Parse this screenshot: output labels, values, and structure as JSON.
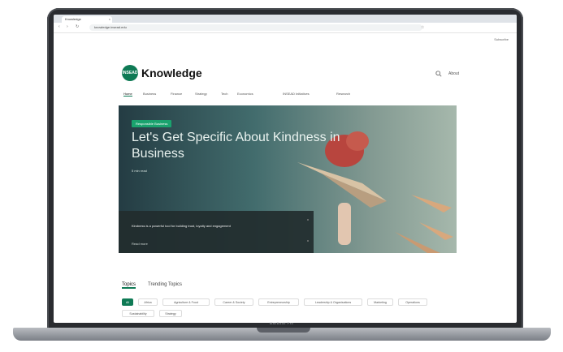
{
  "device": {
    "label": "MacBook Pro"
  },
  "browser": {
    "tab_title": "Knowledge",
    "tab_close": "×",
    "url": "knowledge.insead.edu",
    "nav": {
      "back": "‹",
      "forward": "›",
      "reload": "↻"
    }
  },
  "header": {
    "utility_link": "Subscribe",
    "logo_mark": "INSEAD",
    "logo_text": "Knowledge",
    "search_icon": "search-icon",
    "sub_link": "About"
  },
  "nav": {
    "items": [
      {
        "label": "Home",
        "active": true
      },
      {
        "label": "Business",
        "active": false
      },
      {
        "label": "Finance",
        "active": false
      },
      {
        "label": "Strategy",
        "active": false
      },
      {
        "label": "Tech",
        "active": false
      },
      {
        "label": "Economics",
        "active": false
      },
      {
        "label": "INSEAD Initiatives",
        "active": false
      },
      {
        "label": "Research",
        "active": false
      }
    ]
  },
  "hero": {
    "badge": "Responsible Business",
    "title": "Let's Get Specific About Kindness in Business",
    "meta": "5 min read",
    "card_text": "Kindness is a powerful tool for building trust, loyalty and engagement",
    "card_read": "Read more",
    "colors": {
      "accent": "#1aa36e",
      "dark": "#243c43"
    }
  },
  "topics": {
    "tabs": [
      {
        "label": "Topics",
        "active": true
      },
      {
        "label": "Trending Topics",
        "active": false
      }
    ],
    "chips": [
      {
        "label": "All",
        "selected": true
      },
      {
        "label": "Africa",
        "selected": false
      },
      {
        "label": "Agriculture & Food",
        "selected": false
      },
      {
        "label": "Career & Society",
        "selected": false
      },
      {
        "label": "Entrepreneurship",
        "selected": false
      },
      {
        "label": "Leadership & Organisations",
        "selected": false
      },
      {
        "label": "Marketing",
        "selected": false
      },
      {
        "label": "Operations",
        "selected": false
      },
      {
        "label": "Sustainability",
        "selected": false
      },
      {
        "label": "Strategy",
        "selected": false
      }
    ]
  },
  "brand": {
    "green": "#0f7a55"
  }
}
